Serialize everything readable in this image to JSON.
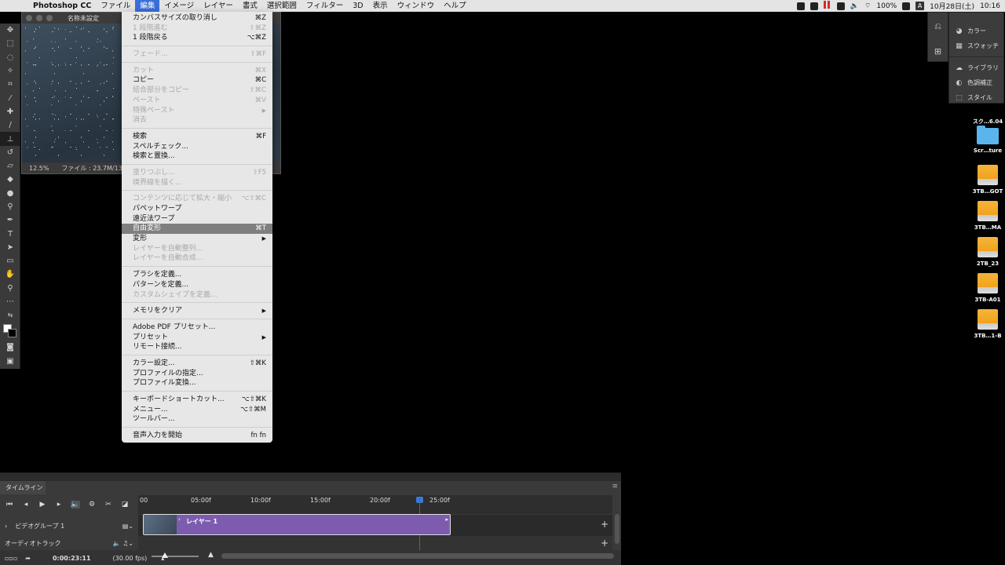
{
  "menubar": {
    "app_name": "Photoshop CC",
    "menus": [
      "ファイル",
      "編集",
      "イメージ",
      "レイヤー",
      "書式",
      "選択範囲",
      "フィルター",
      "3D",
      "表示",
      "ウィンドウ",
      "ヘルプ"
    ],
    "active_menu": "編集",
    "battery": "100%",
    "input_mode": "A",
    "date": "10月28日(土)",
    "time": "10:16"
  },
  "document": {
    "title": "名称未設定",
    "zoom": "12.5%",
    "file_info": "ファイル : 23.7M/130..."
  },
  "edit_menu": {
    "groups": [
      [
        {
          "label": "カンバスサイズの取り消し",
          "shortcut": "⌘Z",
          "disabled": false
        },
        {
          "label": "1 段階進む",
          "shortcut": "⇧⌘Z",
          "disabled": true
        },
        {
          "label": "1 段階戻る",
          "shortcut": "⌥⌘Z",
          "disabled": false
        }
      ],
      [
        {
          "label": "フェード...",
          "shortcut": "⇧⌘F",
          "disabled": true
        }
      ],
      [
        {
          "label": "カット",
          "shortcut": "⌘X",
          "disabled": true
        },
        {
          "label": "コピー",
          "shortcut": "⌘C",
          "disabled": false
        },
        {
          "label": "結合部分をコピー",
          "shortcut": "⇧⌘C",
          "disabled": true
        },
        {
          "label": "ペースト",
          "shortcut": "⌘V",
          "disabled": true
        },
        {
          "label": "特殊ペースト",
          "shortcut": "▶",
          "disabled": true,
          "submenu": true
        },
        {
          "label": "消去",
          "shortcut": "",
          "disabled": true
        }
      ],
      [
        {
          "label": "検索",
          "shortcut": "⌘F",
          "disabled": false
        },
        {
          "label": "スペルチェック...",
          "shortcut": "",
          "disabled": false
        },
        {
          "label": "検索と置換...",
          "shortcut": "",
          "disabled": false
        }
      ],
      [
        {
          "label": "塗りつぶし...",
          "shortcut": "⇧F5",
          "disabled": true
        },
        {
          "label": "境界線を描く...",
          "shortcut": "",
          "disabled": true
        }
      ],
      [
        {
          "label": "コンテンツに応じて拡大・縮小",
          "shortcut": "⌥⇧⌘C",
          "disabled": true
        },
        {
          "label": "パペットワープ",
          "shortcut": "",
          "disabled": false
        },
        {
          "label": "遠近法ワープ",
          "shortcut": "",
          "disabled": false
        },
        {
          "label": "自由変形",
          "shortcut": "⌘T",
          "disabled": false,
          "highlighted": true
        },
        {
          "label": "変形",
          "shortcut": "▶",
          "disabled": false,
          "submenu": true
        },
        {
          "label": "レイヤーを自動整列...",
          "shortcut": "",
          "disabled": true
        },
        {
          "label": "レイヤーを自動合成...",
          "shortcut": "",
          "disabled": true
        }
      ],
      [
        {
          "label": "ブラシを定義...",
          "shortcut": "",
          "disabled": false
        },
        {
          "label": "パターンを定義...",
          "shortcut": "",
          "disabled": false
        },
        {
          "label": "カスタムシェイプを定義...",
          "shortcut": "",
          "disabled": true
        }
      ],
      [
        {
          "label": "メモリをクリア",
          "shortcut": "▶",
          "disabled": false,
          "submenu": true
        }
      ],
      [
        {
          "label": "Adobe PDF プリセット...",
          "shortcut": "",
          "disabled": false
        },
        {
          "label": "プリセット",
          "shortcut": "▶",
          "disabled": false,
          "submenu": true
        },
        {
          "label": "リモート接続...",
          "shortcut": "",
          "disabled": false
        }
      ],
      [
        {
          "label": "カラー設定...",
          "shortcut": "⇧⌘K",
          "disabled": false
        },
        {
          "label": "プロファイルの指定...",
          "shortcut": "",
          "disabled": false
        },
        {
          "label": "プロファイル変換...",
          "shortcut": "",
          "disabled": false
        }
      ],
      [
        {
          "label": "キーボードショートカット...",
          "shortcut": "⌥⇧⌘K",
          "disabled": false
        },
        {
          "label": "メニュー...",
          "shortcut": "⌥⇧⌘M",
          "disabled": false
        },
        {
          "label": "ツールバー...",
          "shortcut": "",
          "disabled": false
        }
      ],
      [
        {
          "label": "音声入力を開始",
          "shortcut": "fn fn",
          "disabled": false
        }
      ]
    ]
  },
  "right_panel": {
    "items_top": [
      {
        "icon": "color-wheel-icon",
        "glyph": "◕",
        "label": "カラー"
      },
      {
        "icon": "swatches-grid-icon",
        "glyph": "▦",
        "label": "スウォッチ"
      }
    ],
    "items_bottom": [
      {
        "icon": "libraries-icon",
        "glyph": "☁",
        "label": "ライブラリ"
      },
      {
        "icon": "adjustments-icon",
        "glyph": "◐",
        "label": "色調補正"
      },
      {
        "icon": "styles-icon",
        "glyph": "⬚",
        "label": "スタイル"
      }
    ]
  },
  "desktop_icons": [
    {
      "label": "スク…6.04",
      "kind": "file"
    },
    {
      "label": "Scr…ture",
      "kind": "folder"
    },
    {
      "label": "3TB…GOT",
      "kind": "drive"
    },
    {
      "label": "3TB…MA",
      "kind": "drive"
    },
    {
      "label": "2TB_23",
      "kind": "drive"
    },
    {
      "label": "3TB-A01",
      "kind": "drive"
    },
    {
      "label": "3TB…1-B",
      "kind": "drive"
    }
  ],
  "timeline": {
    "tab_label": "タイムライン",
    "ruler_ticks": [
      "00",
      "05:00f",
      "10:00f",
      "15:00f",
      "20:00f",
      "25:00f"
    ],
    "video_group_label": "ビデオグループ 1",
    "clip_label": "レイヤー 1",
    "audio_track_label": "オーディオトラック",
    "current_time": "0:00:23:11",
    "fps": "(30.00 fps)"
  },
  "colors": {
    "menu_highlight": "#7f7f7f",
    "active_menu": "#3a6fd8",
    "clip": "#7d5cb0",
    "playhead": "#d63030"
  }
}
